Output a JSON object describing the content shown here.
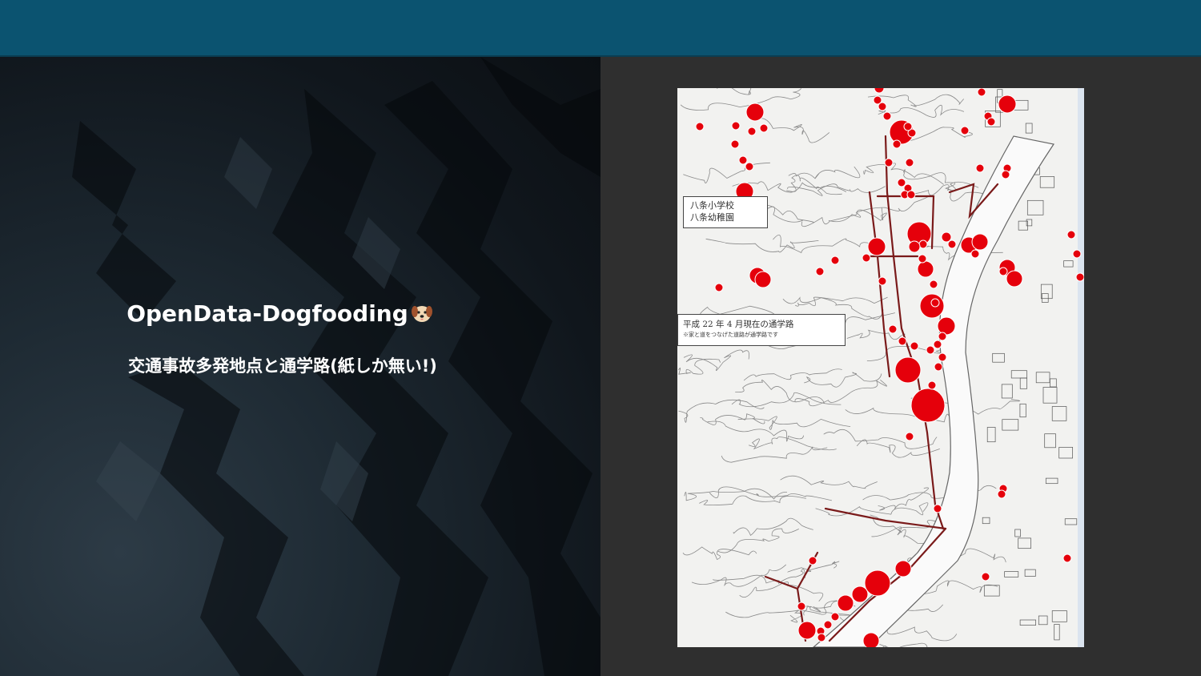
{
  "slide": {
    "title": "OpenData-Dogfooding",
    "subtitle": "交通事故多発地点と通学路(紙しか無い!)"
  },
  "map": {
    "legend_school": [
      "八条小学校",
      "八条幼稚園"
    ],
    "legend_route": "平成 22 年 4 月現在の通学路",
    "legend_route_note": "※家と道をつなげた道路が通学路です",
    "accident_color": "#e5000b",
    "route_color": "#7a1a1a"
  },
  "icons": [
    "dog-icon"
  ]
}
